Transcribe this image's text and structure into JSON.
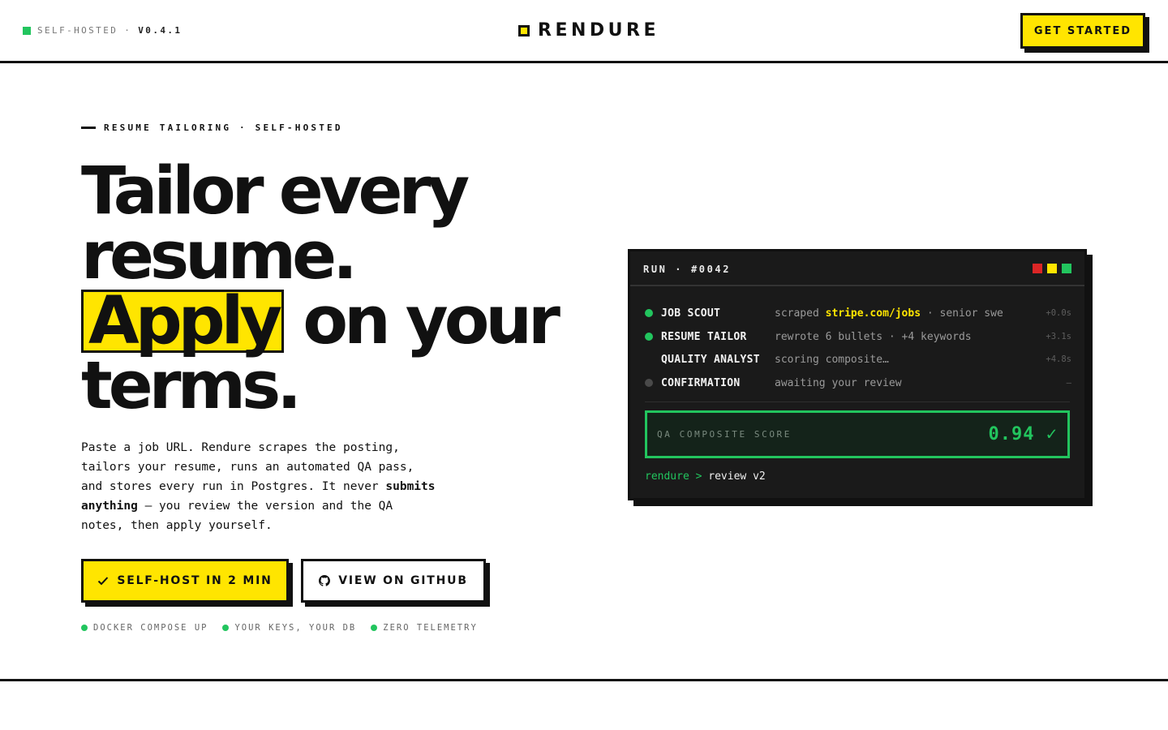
{
  "header": {
    "badge": "SELF-HOSTED",
    "separator": "·",
    "version": "V0.4.1",
    "brand": "RENDURE",
    "cta": "GET STARTED"
  },
  "hero": {
    "eyebrow": "RESUME TAILORING · SELF-HOSTED",
    "headline": {
      "line1": "Tailor every",
      "line2": "resume.",
      "highlight": "Apply",
      "line3_rest": " on your",
      "line4": "terms."
    },
    "description_before": "Paste a job URL. Rendure scrapes the posting, tailors your resume, runs an automated QA pass, and stores every run in Postgres. It never ",
    "description_bold": "submits anything",
    "description_after": " — you review the version and the QA notes, then apply yourself.",
    "primary_cta": "SELF-HOST IN 2 MIN",
    "secondary_cta": "VIEW ON GITHUB",
    "features": [
      "DOCKER COMPOSE UP",
      "YOUR KEYS, YOUR DB",
      "ZERO TELEMETRY"
    ]
  },
  "terminal": {
    "title": "RUN · #0042",
    "steps": [
      {
        "agent": "JOB SCOUT",
        "message_pre": "scraped ",
        "message_em": "stripe.com/jobs",
        "message_post": " · senior swe",
        "time": "+0.0s",
        "status": "done"
      },
      {
        "agent": "RESUME TAILOR",
        "message_pre": "rewrote 6 bullets · +4 keywords",
        "message_em": "",
        "message_post": "",
        "time": "+3.1s",
        "status": "done"
      },
      {
        "agent": "QUALITY ANALYST",
        "message_pre": "scoring composite…",
        "message_em": "",
        "message_post": "",
        "time": "+4.8s",
        "status": "running"
      },
      {
        "agent": "CONFIRMATION",
        "message_pre": "awaiting your review",
        "message_em": "",
        "message_post": "",
        "time": "—",
        "status": "pending"
      }
    ],
    "score_label": "QA COMPOSITE SCORE",
    "score_value": "0.94 ✓",
    "prompt_name": "rendure",
    "prompt_symbol": ">",
    "prompt_command": "review v2"
  },
  "colors": {
    "accent_yellow": "#FFE500",
    "success_green": "#22c55e",
    "ink": "#111111",
    "terminal_bg": "#1a1a1a",
    "light_red": "#dc2626",
    "light_yellow": "#FFE500",
    "light_green": "#22c55e",
    "pending_dot": "#4a4a4a"
  },
  "icons": {
    "badge": "green-square-icon",
    "logo": "yellow-square-logo-icon",
    "primary_cta": "check-icon",
    "secondary_cta": "github-icon",
    "feature": "green-dot-icon"
  }
}
